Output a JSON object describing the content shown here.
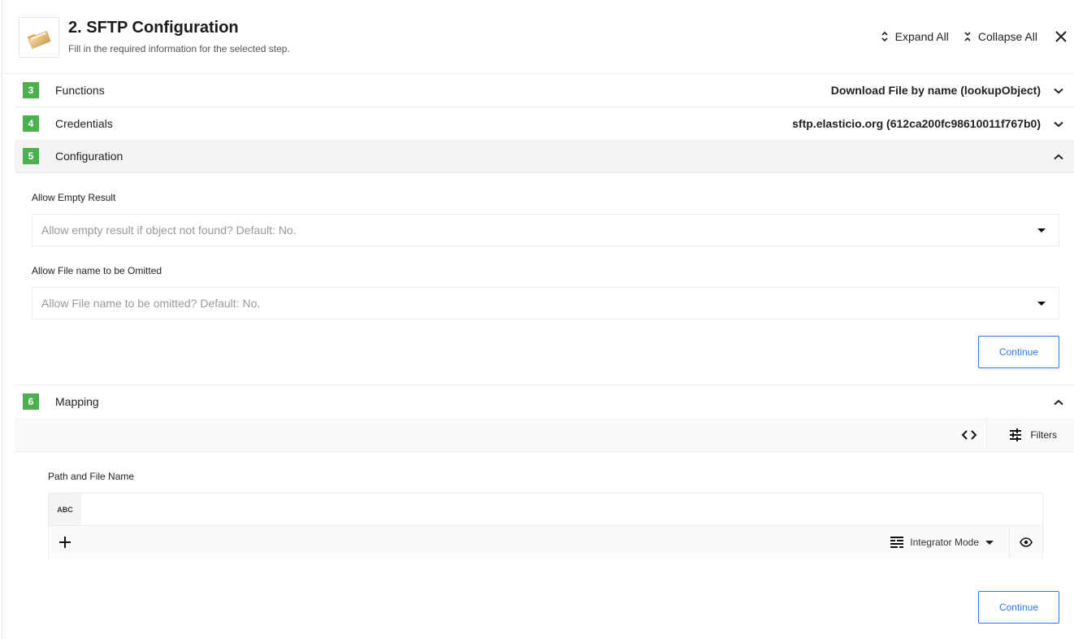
{
  "header": {
    "title": "2. SFTP Configuration",
    "subtitle": "Fill in the required information for the selected step.",
    "icon": "folder-icon",
    "expand_all_label": "Expand All",
    "collapse_all_label": "Collapse All",
    "close_icon": "close-icon"
  },
  "sections": [
    {
      "number": "3",
      "label": "Functions",
      "value": "Download File by name (lookupObject)",
      "expanded": false
    },
    {
      "number": "4",
      "label": "Credentials",
      "value": "sftp.elasticio.org (612ca200fc98610011f767b0)",
      "expanded": false
    },
    {
      "number": "5",
      "label": "Configuration",
      "value": "",
      "expanded": true
    },
    {
      "number": "6",
      "label": "Mapping",
      "value": "",
      "expanded": true
    }
  ],
  "configuration": {
    "fields": [
      {
        "label": "Allow Empty Result",
        "placeholder": "Allow empty result if object not found? Default: No."
      },
      {
        "label": "Allow File name to be Omitted",
        "placeholder": "Allow File name to be omitted? Default: No."
      }
    ],
    "continue_label": "Continue"
  },
  "mapping": {
    "toolbar": {
      "code_toggle_icon": "code-icon",
      "filters_label": "Filters"
    },
    "field": {
      "label": "Path and File Name",
      "type_badge": "ABC",
      "value": ""
    },
    "mode_label": "Integrator Mode",
    "continue_label": "Continue"
  },
  "colors": {
    "badge_green": "#4caf50",
    "accent_blue": "#2e7be6"
  }
}
